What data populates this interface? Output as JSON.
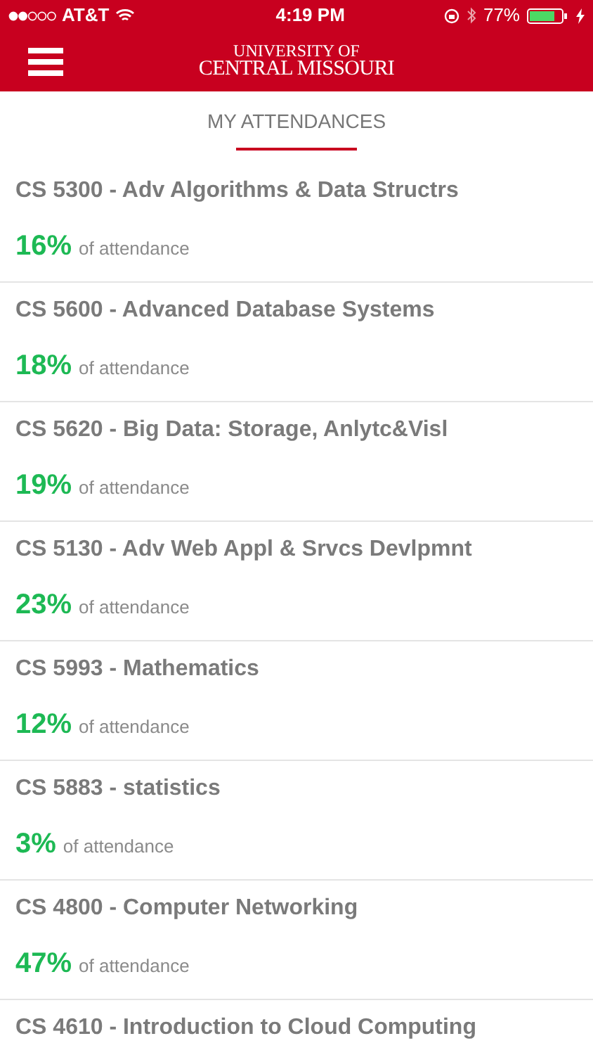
{
  "status_bar": {
    "carrier": "AT&T",
    "time": "4:19 PM",
    "battery": "77%"
  },
  "header": {
    "logo_line_1": "UNIVERSITY OF",
    "logo_line_2": "CENTRAL MISSOURI"
  },
  "page_title": "MY ATTENDANCES",
  "courses": [
    {
      "name": "CS 5300 - Adv Algorithms & Data Structrs",
      "percent": "16%",
      "caption": "of attendance"
    },
    {
      "name": "CS 5600 - Advanced Database Systems",
      "percent": "18%",
      "caption": "of attendance"
    },
    {
      "name": "CS 5620 - Big Data: Storage, Anlytc&Visl",
      "percent": "19%",
      "caption": "of attendance"
    },
    {
      "name": "CS 5130 - Adv Web Appl & Srvcs Devlpmnt",
      "percent": "23%",
      "caption": "of attendance"
    },
    {
      "name": "CS 5993 - Mathematics",
      "percent": "12%",
      "caption": "of attendance"
    },
    {
      "name": "CS 5883 - statistics",
      "percent": "3%",
      "caption": "of attendance"
    },
    {
      "name": "CS 4800 - Computer Networking",
      "percent": "47%",
      "caption": "of attendance"
    },
    {
      "name": "CS 4610 - Introduction to Cloud Computing"
    }
  ]
}
